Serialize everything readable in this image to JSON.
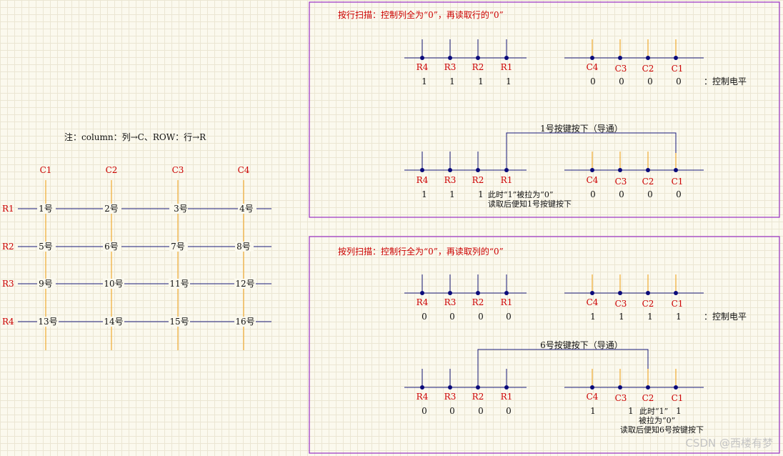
{
  "left": {
    "note": "注：column：列→C、ROW：行→R",
    "cols": [
      "C1",
      "C2",
      "C3",
      "C4"
    ],
    "rows": [
      "R1",
      "R2",
      "R3",
      "R4"
    ],
    "keys": [
      [
        "1号",
        "2号",
        "3号",
        "4号"
      ],
      [
        "5号",
        "6号",
        "7号",
        "8号"
      ],
      [
        "9号",
        "10号",
        "11号",
        "12号"
      ],
      [
        "13号",
        "14号",
        "15号",
        "16号"
      ]
    ]
  },
  "panel1": {
    "title": "按行扫描：控制列全为“0”，再读取行的“0”",
    "top_r_labels": [
      "R4",
      "R3",
      "R2",
      "R1"
    ],
    "top_r_values": [
      "1",
      "1",
      "1",
      "1"
    ],
    "top_c_labels": [
      "C4",
      "C3",
      "C2",
      "C1"
    ],
    "top_c_values": [
      "0",
      "0",
      "0",
      "0"
    ],
    "control_label": "：控制电平",
    "press_label": "1号按键按下（导通）",
    "bot_r_labels": [
      "R4",
      "R3",
      "R2",
      "R1"
    ],
    "bot_r_values": [
      "1",
      "1",
      "1"
    ],
    "bot_c_labels": [
      "C4",
      "C3",
      "C2",
      "C1"
    ],
    "bot_c_values": [
      "0",
      "0",
      "0",
      "0"
    ],
    "note_line1": "此时“1”被拉为“0”",
    "note_line2": "读取后便知1号按键按下"
  },
  "panel2": {
    "title": "按列扫描：控制行全为“0”，再读取列的“0”",
    "top_r_labels": [
      "R4",
      "R3",
      "R2",
      "R1"
    ],
    "top_r_values": [
      "0",
      "0",
      "0",
      "0"
    ],
    "top_c_labels": [
      "C4",
      "C3",
      "C2",
      "C1"
    ],
    "top_c_values": [
      "1",
      "1",
      "1",
      "1"
    ],
    "control_label": "：控制电平",
    "press_label": "6号按键按下（导通）",
    "bot_r_labels": [
      "R4",
      "R3",
      "R2",
      "R1"
    ],
    "bot_r_values": [
      "0",
      "0",
      "0",
      "0"
    ],
    "bot_c_labels": [
      "C4",
      "C3",
      "C2",
      "C1"
    ],
    "bot_c_values": [
      "1",
      "1",
      "1"
    ],
    "note_line1": "此时“1”",
    "note_line2": "被拉为“0”",
    "note_line3": "读取后便知6号按键按下"
  },
  "watermark": "CSDN @西楼有梦",
  "colors": {
    "panel_border": "#9a2fc4",
    "label_red": "#cc0000",
    "wire_blue": "#1a1a7a",
    "wire_orange": "#f0b040"
  }
}
